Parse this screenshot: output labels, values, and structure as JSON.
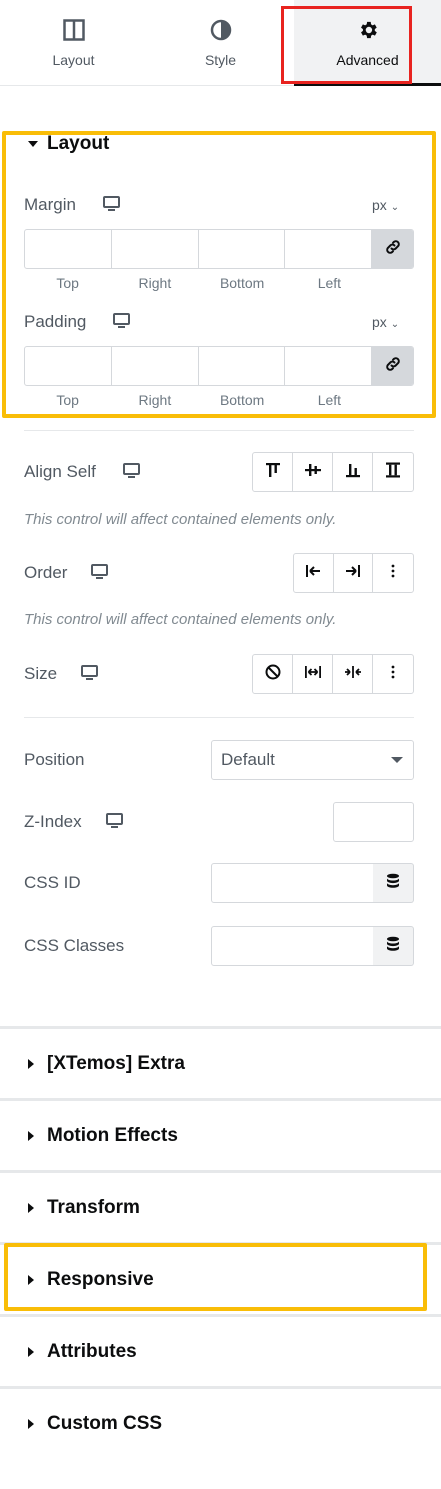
{
  "tabs": [
    {
      "label": "Layout",
      "icon": "columns-icon"
    },
    {
      "label": "Style",
      "icon": "contrast-icon"
    },
    {
      "label": "Advanced",
      "icon": "gear-icon",
      "active": true
    }
  ],
  "layout_section": {
    "title": "Layout",
    "margin": {
      "label": "Margin",
      "unit": "px",
      "values": [
        "",
        "",
        "",
        ""
      ],
      "sides": [
        "Top",
        "Right",
        "Bottom",
        "Left"
      ]
    },
    "padding": {
      "label": "Padding",
      "unit": "px",
      "values": [
        "",
        "",
        "",
        ""
      ],
      "sides": [
        "Top",
        "Right",
        "Bottom",
        "Left"
      ]
    },
    "align_self": {
      "label": "Align Self",
      "note": "This control will affect contained elements only."
    },
    "order": {
      "label": "Order",
      "note": "This control will affect contained elements only."
    },
    "size": {
      "label": "Size"
    },
    "position": {
      "label": "Position",
      "value": "Default"
    },
    "z_index": {
      "label": "Z-Index",
      "value": ""
    },
    "css_id": {
      "label": "CSS ID",
      "value": ""
    },
    "css_classes": {
      "label": "CSS Classes",
      "value": ""
    }
  },
  "collapsed_sections": [
    {
      "title": "[XTemos] Extra"
    },
    {
      "title": "Motion Effects"
    },
    {
      "title": "Transform"
    },
    {
      "title": "Responsive"
    },
    {
      "title": "Attributes"
    },
    {
      "title": "Custom CSS"
    }
  ],
  "colors": {
    "highlight_red": "#e8231f",
    "highlight_yellow": "#f9bd07"
  }
}
